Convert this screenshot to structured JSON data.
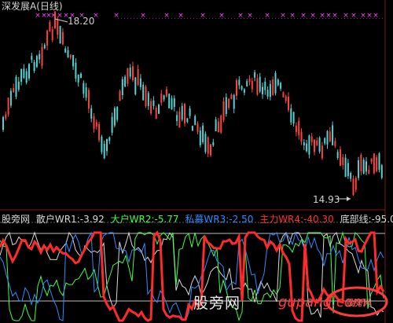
{
  "chart": {
    "title": "深发展A(日线)",
    "high_label": "18.20",
    "low_label": "14.93",
    "colors": {
      "up": "#ff4040",
      "down": "#54d2d2",
      "marker": "#ff40ff",
      "grid": "#7a1a1a"
    }
  },
  "indicator": {
    "name": "股旁网",
    "items": [
      {
        "label": "散户WR1:",
        "value": "-3.92",
        "color": "#d8d8d8"
      },
      {
        "label": "大户WR2:",
        "value": "-5.77",
        "color": "#40ff40"
      },
      {
        "label": "私募WR3:",
        "value": "-2.50",
        "color": "#2f8cff"
      },
      {
        "label": "主力WR4:",
        "value": "-40.30",
        "color": "#ff3030"
      },
      {
        "label": "底部线:",
        "value": "-95.00",
        "color": "#d8d8d8"
      }
    ]
  },
  "watermark": {
    "cn": "股旁网",
    "site": "gupang.com",
    "corner": "股旁网"
  }
}
